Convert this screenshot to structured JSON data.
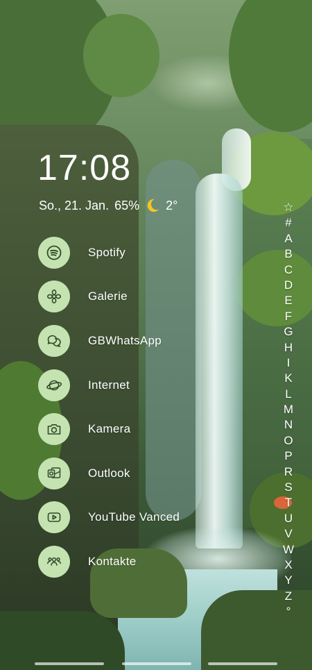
{
  "status": {
    "clock": "17:08",
    "date": "So., 21. Jan.",
    "battery": "65%",
    "weather_icon": "moon-icon",
    "temperature": "2°"
  },
  "apps": [
    {
      "label": "Spotify",
      "icon": "spotify-icon"
    },
    {
      "label": "Galerie",
      "icon": "flower-icon"
    },
    {
      "label": "GBWhatsApp",
      "icon": "chat-bubbles-icon"
    },
    {
      "label": "Internet",
      "icon": "planet-icon"
    },
    {
      "label": "Kamera",
      "icon": "camera-icon"
    },
    {
      "label": "Outlook",
      "icon": "outlook-icon"
    },
    {
      "label": "YouTube Vanced",
      "icon": "youtube-icon"
    },
    {
      "label": "Kontakte",
      "icon": "contacts-icon"
    }
  ],
  "alphabet_index": [
    "☆",
    "#",
    "A",
    "B",
    "C",
    "D",
    "E",
    "F",
    "G",
    "H",
    "I",
    "K",
    "L",
    "M",
    "N",
    "O",
    "P",
    "R",
    "S",
    "T",
    "U",
    "V",
    "W",
    "X",
    "Y",
    "Z",
    "°"
  ],
  "colors": {
    "icon_circle": "#c4e3b0",
    "icon_glyph": "#2f4a2a"
  }
}
